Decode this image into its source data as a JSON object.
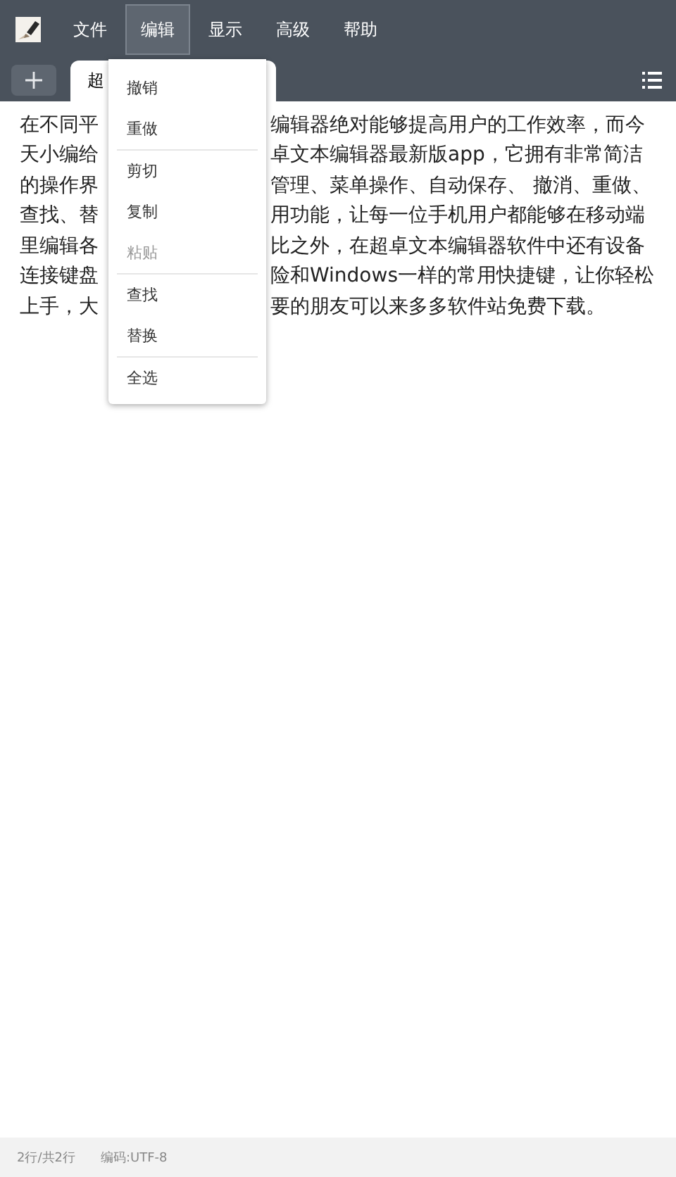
{
  "menu_bar": {
    "items": [
      {
        "label": "文件",
        "selected": false
      },
      {
        "label": "编辑",
        "selected": true
      },
      {
        "label": "显示",
        "selected": false
      },
      {
        "label": "高级",
        "selected": false
      },
      {
        "label": "帮助",
        "selected": false
      }
    ]
  },
  "tabs": [
    {
      "label": "超",
      "selected": true
    }
  ],
  "editor": {
    "lines": [
      {
        "left": "在不同平",
        "right": "编辑器绝对能够提高用户的工作效率，而今"
      },
      {
        "left": "天小编给",
        "right": "卓文本编辑器最新版app，它拥有非常简洁"
      },
      {
        "left": "的操作界",
        "right": "管理、菜单操作、自动保存、 撤消、重做、"
      },
      {
        "left": "查找、替",
        "right": "用功能，让每一位手机用户都能够在移动端"
      },
      {
        "left": "里编辑各",
        "right": "比之外，在超卓文本编辑器软件中还有设备"
      },
      {
        "left": "连接键盘",
        "right": "险和Windows一样的常用快捷键，让你轻松"
      },
      {
        "left": "上手，大",
        "right": "要的朋友可以来多多软件站免费下载。"
      }
    ]
  },
  "edit_menu": {
    "groups": [
      [
        {
          "label": "撤销",
          "disabled": false
        },
        {
          "label": "重做",
          "disabled": false
        }
      ],
      [
        {
          "label": "剪切",
          "disabled": false
        },
        {
          "label": "复制",
          "disabled": false
        },
        {
          "label": "粘贴",
          "disabled": true
        }
      ],
      [
        {
          "label": "查找",
          "disabled": false
        },
        {
          "label": "替换",
          "disabled": false
        }
      ],
      [
        {
          "label": "全选",
          "disabled": false
        }
      ]
    ]
  },
  "status_bar": {
    "position": "2行/共2行",
    "encoding": "编码:UTF-8"
  }
}
